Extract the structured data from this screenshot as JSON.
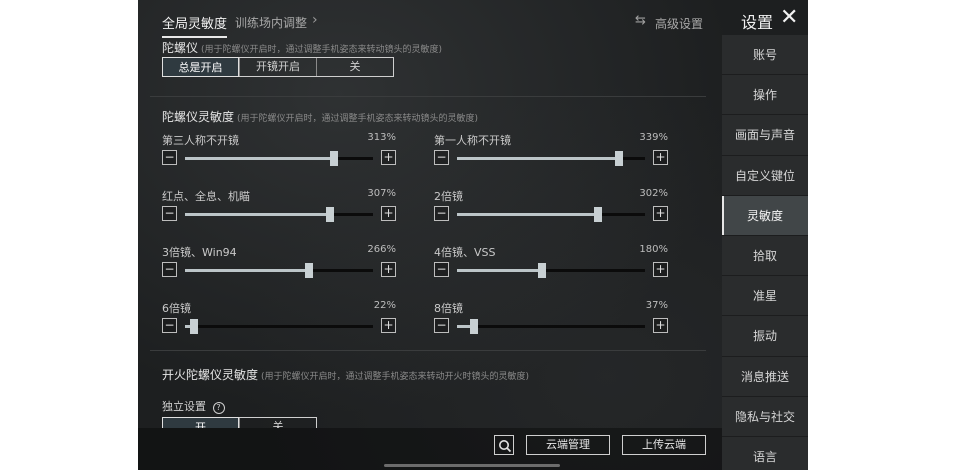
{
  "tabs": {
    "global": "全局灵敏度",
    "training": "训练场内调整",
    "advanced": "高级设置"
  },
  "icons": {
    "chevron": "chevron-right-icon",
    "advanced": "swap-arrows-icon",
    "close": "close-icon",
    "search": "search-icon"
  },
  "header": {
    "title": "设置"
  },
  "gyro": {
    "title": "陀螺仪",
    "note": "(用于陀螺仪开启时，通过调整手机姿态来转动镜头的灵敏度)",
    "options": [
      "总是开启",
      "开镜开启",
      "关"
    ],
    "selected": 0
  },
  "gyro_sens": {
    "title": "陀螺仪灵敏度",
    "note": "(用于陀螺仪开启时，通过调整手机姿态来转动镜头的灵敏度)",
    "sliders": [
      {
        "label": "第三人称不开镜",
        "value": "313%",
        "level": 0.79
      },
      {
        "label": "第一人称不开镜",
        "value": "339%",
        "level": 0.86
      },
      {
        "label": "红点、全息、机瞄",
        "value": "307%",
        "level": 0.77
      },
      {
        "label": "2倍镜",
        "value": "302%",
        "level": 0.75
      },
      {
        "label": "3倍镜、Win94",
        "value": "266%",
        "level": 0.66
      },
      {
        "label": "4倍镜、VSS",
        "value": "180%",
        "level": 0.45
      },
      {
        "label": "6倍镜",
        "value": "22%",
        "level": 0.05
      },
      {
        "label": "8倍镜",
        "value": "37%",
        "level": 0.09
      }
    ]
  },
  "fire_gyro": {
    "title": "开火陀螺仪灵敏度",
    "note": "(用于陀螺仪开启时，通过调整手机姿态来转动开火时镜头的灵敏度)",
    "standalone": "独立设置",
    "options": [
      "开",
      "关"
    ]
  },
  "bottom": {
    "cloud_manage": "云端管理",
    "upload_cloud": "上传云端"
  },
  "nav": {
    "items": [
      "账号",
      "操作",
      "画面与声音",
      "自定义键位",
      "灵敏度",
      "拾取",
      "准星",
      "振动",
      "消息推送",
      "隐私与社交",
      "语言"
    ],
    "active": 4
  }
}
